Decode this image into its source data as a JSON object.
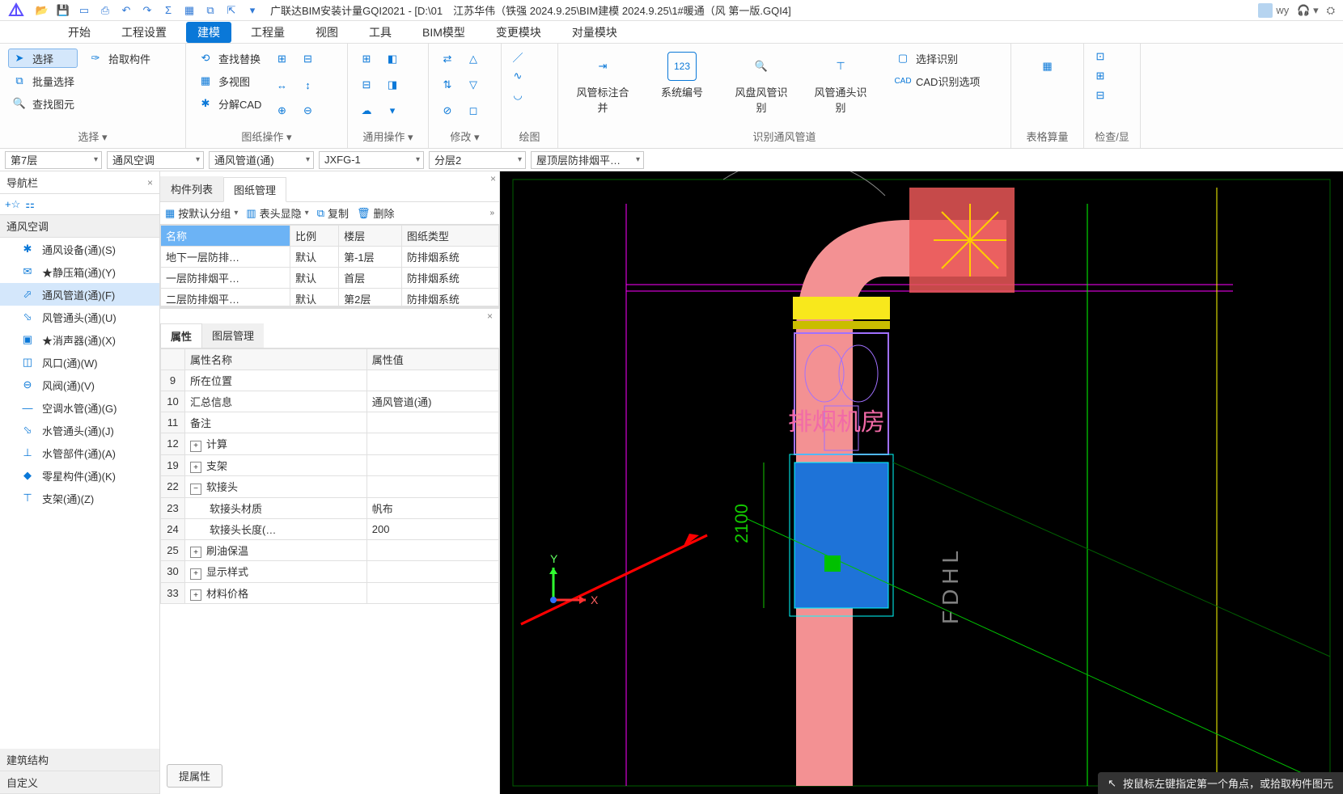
{
  "app": {
    "title": "广联达BIM安装计量GQI2021 - [D:\\01　江苏华伟（铁强 2024.9.25\\BIM建模 2024.9.25\\1#暖通（风 第一版.GQI4]",
    "user": "wy"
  },
  "menu": {
    "tabs": [
      "开始",
      "工程设置",
      "建模",
      "工程量",
      "视图",
      "工具",
      "BIM模型",
      "变更模块",
      "对量模块"
    ],
    "active_index": 2
  },
  "ribbon": {
    "select": {
      "label": "选择 ▾",
      "items": [
        "选择",
        "批量选择",
        "查找图元",
        "拾取构件"
      ]
    },
    "drawing": {
      "label": "图纸操作 ▾",
      "items": [
        "查找替换",
        "多视图",
        "分解CAD"
      ]
    },
    "general": {
      "label": "通用操作 ▾"
    },
    "modify": {
      "label": "修改 ▾"
    },
    "draw": {
      "label": "绘图"
    },
    "recognize": {
      "label": "识别通风管道",
      "big": [
        "风管标注合并",
        "系统编号",
        "风盘风管识别",
        "风管通头识别"
      ],
      "side": [
        "选择识别",
        "CAD识别选项"
      ]
    },
    "calc": {
      "label": "表格算量"
    },
    "check": {
      "label": "检查/显"
    }
  },
  "filters": {
    "floor": "第7层",
    "system": "通风空调",
    "component": "通风管道(通)",
    "code": "JXFG-1",
    "layer": "分层2",
    "plan": "屋顶层防排烟平…"
  },
  "sidebar": {
    "title": "导航栏",
    "category": "通风空调",
    "items": [
      "通风设备(通)(S)",
      "★静压箱(通)(Y)",
      "通风管道(通)(F)",
      "风管通头(通)(U)",
      "★消声器(通)(X)",
      "风口(通)(W)",
      "风阀(通)(V)",
      "空调水管(通)(G)",
      "水管通头(通)(J)",
      "水管部件(通)(A)",
      "零星构件(通)(K)",
      "支架(通)(Z)"
    ],
    "selected_index": 2,
    "bottom": [
      "建筑结构",
      "自定义"
    ]
  },
  "drawing_panel": {
    "tabs": [
      "构件列表",
      "图纸管理"
    ],
    "active_tab": 1,
    "toolbar": {
      "group_by": "按默认分组",
      "header": "表头显隐",
      "copy": "复制",
      "delete": "删除"
    },
    "columns": [
      "名称",
      "比例",
      "楼层",
      "图纸类型"
    ],
    "rows": [
      {
        "name": "地下一层防排…",
        "ratio": "默认",
        "floor": "第-1层",
        "type": "防排烟系统"
      },
      {
        "name": "一层防排烟平…",
        "ratio": "默认",
        "floor": "首层",
        "type": "防排烟系统"
      },
      {
        "name": "二层防排烟平…",
        "ratio": "默认",
        "floor": "第2层",
        "type": "防排烟系统"
      }
    ]
  },
  "prop_panel": {
    "tabs": [
      "属性",
      "图层管理"
    ],
    "active_tab": 0,
    "columns": [
      "属性名称",
      "属性值"
    ],
    "rows": [
      {
        "idx": "9",
        "name": "所在位置",
        "value": ""
      },
      {
        "idx": "10",
        "name": "汇总信息",
        "value": "通风管道(通)"
      },
      {
        "idx": "11",
        "name": "备注",
        "value": ""
      },
      {
        "idx": "12",
        "name": "计算",
        "value": "",
        "exp": "+"
      },
      {
        "idx": "19",
        "name": "支架",
        "value": "",
        "exp": "+"
      },
      {
        "idx": "22",
        "name": "软接头",
        "value": "",
        "exp": "−"
      },
      {
        "idx": "23",
        "name": "软接头材质",
        "value": "帆布",
        "indent": true
      },
      {
        "idx": "24",
        "name": "软接头长度(…",
        "value": "200",
        "indent": true
      },
      {
        "idx": "25",
        "name": "刷油保温",
        "value": "",
        "exp": "+"
      },
      {
        "idx": "30",
        "name": "显示样式",
        "value": "",
        "exp": "+"
      },
      {
        "idx": "33",
        "name": "材料价格",
        "value": "",
        "exp": "+"
      }
    ],
    "footer_btn": "提属性"
  },
  "canvas": {
    "label_text": "排烟机房",
    "dim_text": "2100",
    "side_text": "FDHL",
    "axis_x": "X",
    "axis_y": "Y"
  },
  "statusbar": {
    "hint": "按鼠标左键指定第一个角点，或拾取构件图元"
  }
}
